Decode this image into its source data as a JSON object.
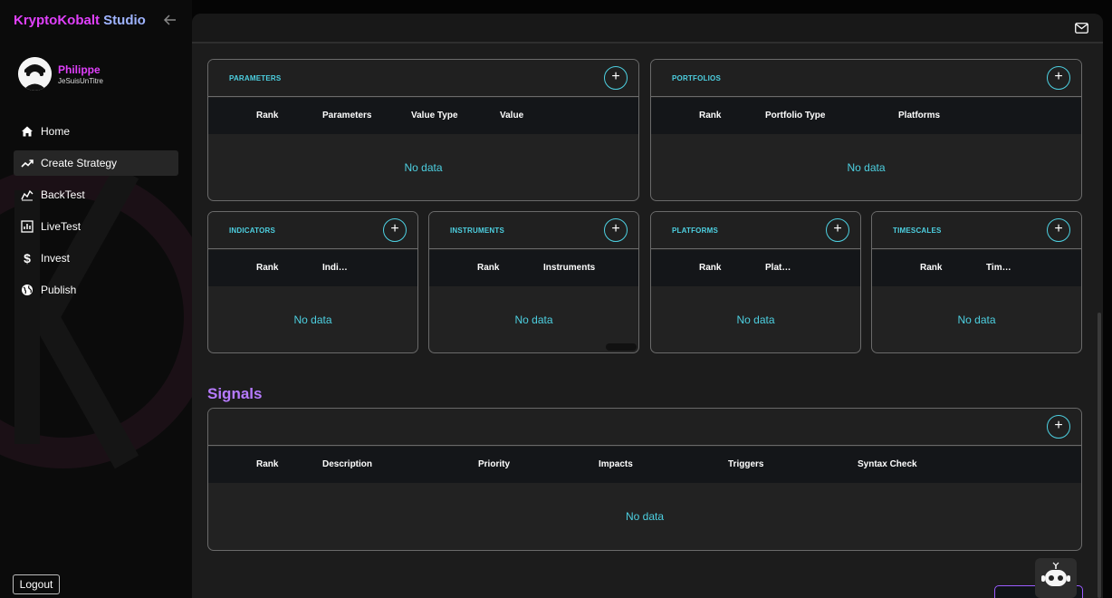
{
  "app": {
    "title_part1": "KryptoKobalt",
    "title_part2": " Studio"
  },
  "user": {
    "name": "Philippe",
    "handle": "JeSuisUnTitre"
  },
  "nav": {
    "items": [
      {
        "label": "Home",
        "icon": "home-icon"
      },
      {
        "label": "Create Strategy",
        "icon": "trending-up-icon",
        "active": true
      },
      {
        "label": "BackTest",
        "icon": "chart-line-icon"
      },
      {
        "label": "LiveTest",
        "icon": "bar-chart-icon"
      },
      {
        "label": "Invest",
        "icon": "dollar-icon"
      },
      {
        "label": "Publish",
        "icon": "globe-icon"
      }
    ],
    "logout_label": "Logout"
  },
  "cards": {
    "parameters": {
      "title": "PARAMETERS",
      "columns": [
        "Rank",
        "Parameters",
        "Value Type",
        "Value"
      ],
      "empty": "No data"
    },
    "portfolios": {
      "title": "PORTFOLIOS",
      "columns": [
        "Rank",
        "Portfolio Type",
        "Platforms"
      ],
      "empty": "No data"
    },
    "indicators": {
      "title": "INDICATORS",
      "columns": [
        "Rank",
        "Indi…"
      ],
      "empty": "No data"
    },
    "instruments": {
      "title": "INSTRUMENTS",
      "columns": [
        "Rank",
        "Instruments"
      ],
      "empty": "No data"
    },
    "platforms": {
      "title": "PLATFORMS",
      "columns": [
        "Rank",
        "Plat…"
      ],
      "empty": "No data"
    },
    "timescales": {
      "title": "TIMESCALES",
      "columns": [
        "Rank",
        "Tim…"
      ],
      "empty": "No data"
    }
  },
  "signals": {
    "title": "Signals",
    "columns": [
      "Rank",
      "Description",
      "Priority",
      "Impacts",
      "Triggers",
      "Syntax Check"
    ],
    "empty": "No data"
  },
  "colors": {
    "accent_cyan": "#4dd0e1",
    "accent_magenta": "#e040fb",
    "signals_purple": "#b77bff"
  }
}
